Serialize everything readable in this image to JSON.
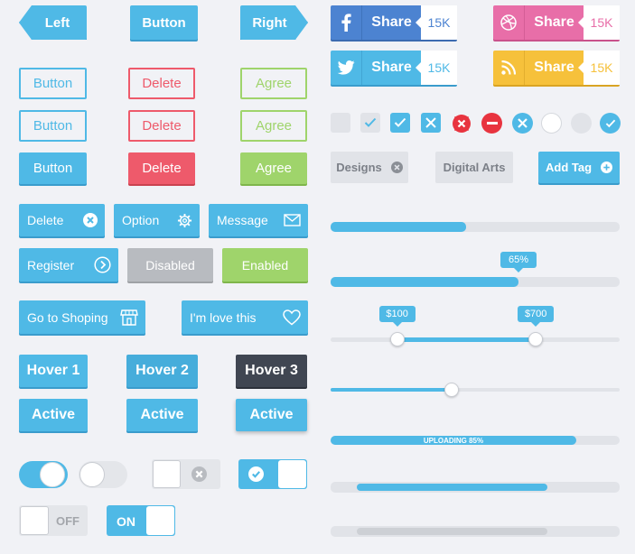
{
  "colors": {
    "blue": "#4fb9e6",
    "red": "#ee5a6b",
    "green": "#9fd46b",
    "gray": "#b8bbc0",
    "dark": "#404652",
    "facebook": "#4c83d1",
    "twitter": "#4fb9e6",
    "dribbble": "#e86ea8",
    "rss": "#f6c13b"
  },
  "arrows": {
    "left": "Left",
    "center": "Button",
    "right": "Right"
  },
  "outline": {
    "button": "Button",
    "delete": "Delete",
    "agree": "Agree"
  },
  "bordered": {
    "button": "Button",
    "delete": "Delete",
    "agree": "Agree"
  },
  "solid": {
    "button": "Button",
    "delete": "Delete",
    "agree": "Agree"
  },
  "icon_buttons": {
    "delete": "Delete",
    "option": "Option",
    "message": "Message",
    "register": "Register",
    "disabled": "Disabled",
    "enabled": "Enabled",
    "shop": "Go to Shoping",
    "love": "I'm love this"
  },
  "hover": {
    "h1": "Hover 1",
    "h2": "Hover 2",
    "h3": "Hover 3"
  },
  "active": {
    "a1": "Active",
    "a2": "Active",
    "a3": "Active"
  },
  "toggles": {
    "off_label": "OFF",
    "on_label": "ON"
  },
  "share": {
    "label": "Share",
    "count": "15K",
    "icons": [
      "facebook-icon",
      "dribbble-icon",
      "twitter-icon",
      "rss-icon"
    ]
  },
  "tags": {
    "designs": "Designs",
    "digital_arts": "Digital Arts",
    "add_tag": "Add Tag"
  },
  "progress": {
    "bar1": 0.47,
    "bar2": 0.65,
    "bar2_label": "65%",
    "uploading": 0.85,
    "uploading_label": "UPLOADING 85%"
  },
  "range": {
    "min_label": "$100",
    "max_label": "$700",
    "min": 0.23,
    "max": 0.71
  },
  "slider": {
    "value": 0.42
  },
  "scroll": {
    "start": 0.09,
    "end": 0.75
  }
}
